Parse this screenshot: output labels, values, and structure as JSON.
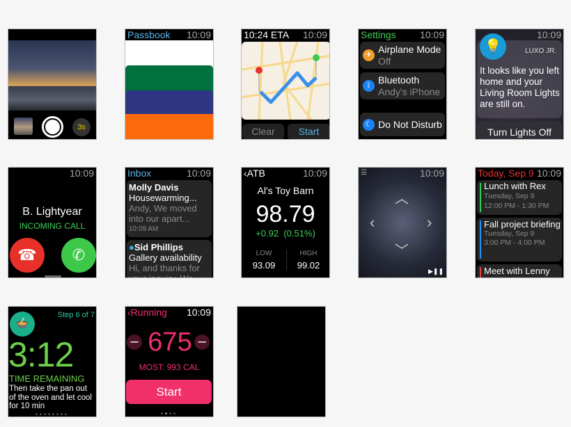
{
  "time": "10:09",
  "camera": {
    "timer": "3s"
  },
  "passbook": {
    "title": "Passbook",
    "colors": [
      "#ffffff",
      "#00703c",
      "#2e3582",
      "#fd6a0c"
    ]
  },
  "maps": {
    "eta": "10:24 ETA",
    "clear": "Clear",
    "start": "Start"
  },
  "settings": {
    "title": "Settings",
    "items": [
      {
        "label": "Airplane Mode",
        "sub": "Off",
        "icon": "airplane-icon",
        "color": "#f39c2a"
      },
      {
        "label": "Bluetooth",
        "sub": "Andy's iPhone",
        "icon": "bluetooth-icon",
        "color": "#1a82f5"
      },
      {
        "label": "Do Not Disturb",
        "sub": "",
        "icon": "moon-icon",
        "color": "#1a82f5"
      }
    ]
  },
  "notification": {
    "app": "LUXO JR.",
    "message": "It looks like you left home and your Living Room Lights are still on.",
    "action": "Turn Lights Off"
  },
  "call": {
    "name": "B. Lightyear",
    "status": "INCOMING CALL"
  },
  "mail": {
    "title": "Inbox",
    "messages": [
      {
        "from": "Molly Davis",
        "subject": "Housewarming...",
        "preview": "Andy, We moved into our apart...",
        "time": "10:09 AM"
      },
      {
        "from": "Sid Phillips",
        "subject": "Gallery availability",
        "preview": "Hi, and thanks for your inquiry. We"
      }
    ]
  },
  "stocks": {
    "back": "ATB",
    "name": "Al's Toy Barn",
    "price": "98.79",
    "change": "+0.92  (0.51%)",
    "low_label": "LOW",
    "low": "93.09",
    "high_label": "HIGH",
    "high": "99.02"
  },
  "calendar": {
    "title": "Today, Sep 9",
    "events": [
      {
        "title": "Lunch with Rex",
        "date": "Tuesday, Sep 9",
        "time": "12:00 PM - 1:30 PM",
        "color": "#2ecc5a"
      },
      {
        "title": "Fall project briefing",
        "date": "Tuesday, Sep 9",
        "time": "3:00 PM - 4:00 PM",
        "color": "#2a8ef0"
      },
      {
        "title": "Meet with Lenny",
        "color": "#e04040"
      }
    ]
  },
  "recipe": {
    "step": "Step 6 of 7",
    "timer": "3:12",
    "label": "TIME REMAINING",
    "instruction": "Then take the pan out of the oven and let cool for 10 min"
  },
  "workout": {
    "back": "Running",
    "value": "675",
    "most": "MOST: 993 CAL",
    "start": "Start"
  }
}
